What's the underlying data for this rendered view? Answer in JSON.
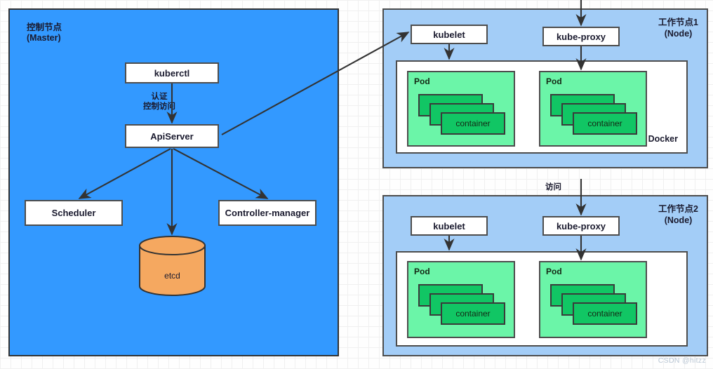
{
  "diagram": {
    "title": "Kubernetes Cluster Architecture",
    "colors": {
      "master_fill": "#3399ff",
      "worker_fill": "#a3cdf7",
      "pod_fill": "#6bf5a8",
      "container_fill": "#11c664",
      "etcd_fill": "#f5a860",
      "box_fill": "#ffffff",
      "stroke": "#4d4d4d",
      "canvas": "#fefefe",
      "grid_line": "#f0f0f0"
    }
  },
  "master": {
    "title": "控制节点\n(Master)",
    "kubectl_label": "kuberctl",
    "apiserver_label": "ApiServer",
    "auth_label": "认证\n控制访问",
    "scheduler_label": "Scheduler",
    "controller_manager_label": "Controller-manager",
    "etcd_label": "etcd"
  },
  "workers": [
    {
      "title": "工作节点1\n(Node)",
      "kubelet_label": "kubelet",
      "kube_proxy_label": "kube-proxy",
      "docker_label": "Docker",
      "pods": [
        {
          "label": "Pod",
          "container_label": "container"
        },
        {
          "label": "Pod",
          "container_label": "container"
        }
      ]
    },
    {
      "title": "工作节点2\n(Node)",
      "kubelet_label": "kubelet",
      "kube_proxy_label": "kube-proxy",
      "docker_label": "",
      "access_label": "访问",
      "pods": [
        {
          "label": "Pod",
          "container_label": "container"
        },
        {
          "label": "Pod",
          "container_label": "container"
        }
      ]
    }
  ],
  "watermark": "CSDN @hitzz"
}
